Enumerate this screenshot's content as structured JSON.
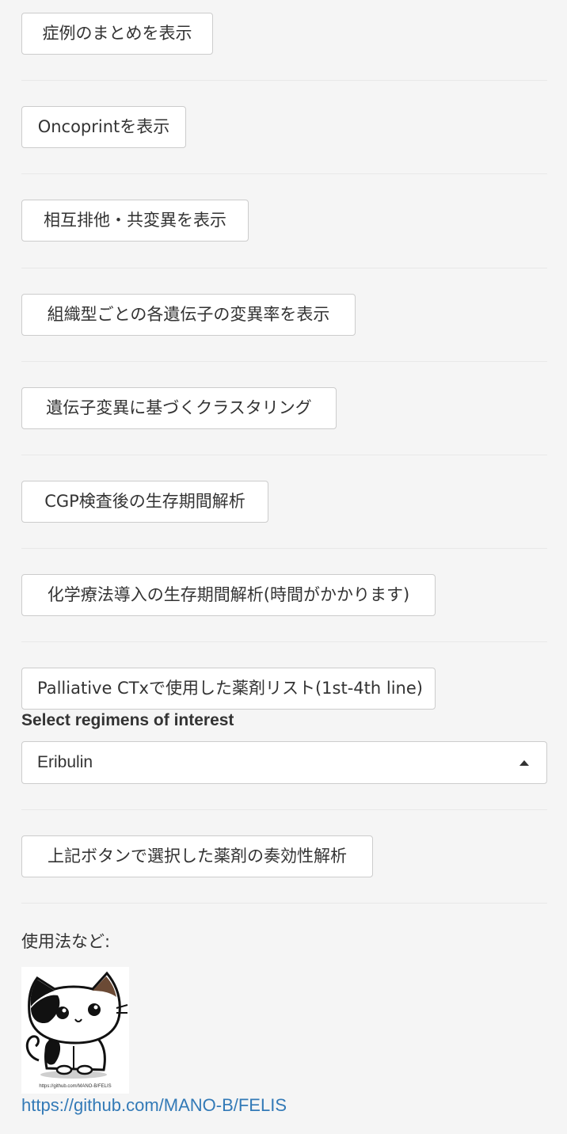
{
  "buttons": [
    {
      "label": "症例のまとめを表示"
    },
    {
      "label": "Oncoprintを表示"
    },
    {
      "label": "相互排他・共変異を表示"
    },
    {
      "label": "組織型ごとの各遺伝子の変異率を表示"
    },
    {
      "label": "遺伝子変異に基づくクラスタリング"
    },
    {
      "label": "CGP検査後の生存期間解析"
    },
    {
      "label": "化学療法導入の生存期間解析(時間がかかります)"
    },
    {
      "label": "Palliative CTxで使用した薬剤リスト(1st-4th line)"
    }
  ],
  "regimen_select": {
    "label": "Select regimens of interest",
    "selected": "Eribulin"
  },
  "analysis_button": {
    "label": "上記ボタンで選択した薬剤の奏効性解析"
  },
  "usage": {
    "label": "使用法など:",
    "logo_caption": "https://github.com/MANO-B/FELIS",
    "link_text": "https://github.com/MANO-B/FELIS"
  }
}
